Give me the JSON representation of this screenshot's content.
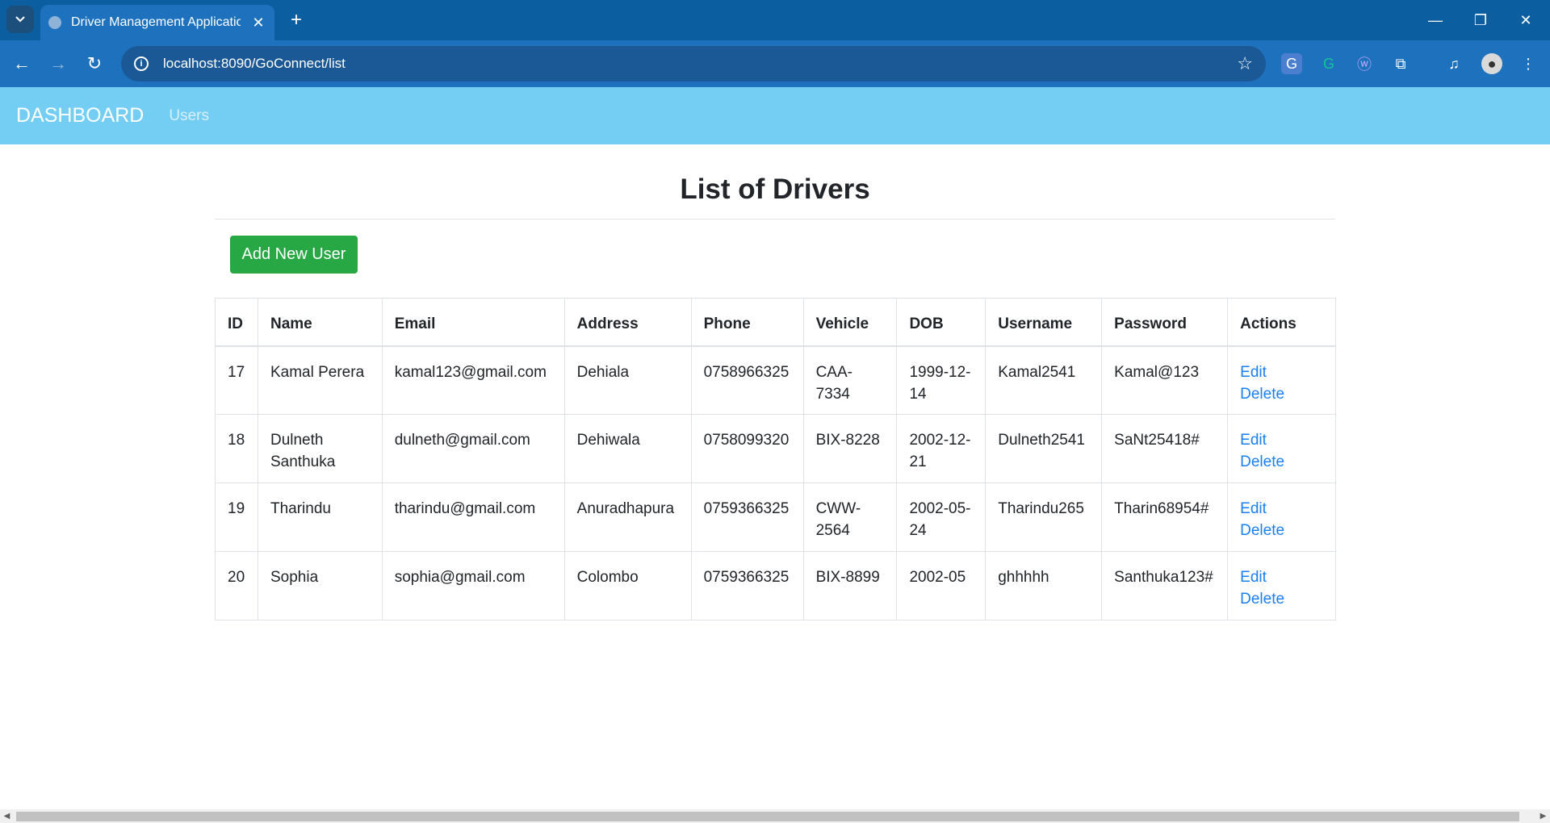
{
  "browser": {
    "tab_title": "Driver Management Application",
    "url": "localhost:8090/GoConnect/list",
    "icons": {
      "tab_search": "chevron-down-icon",
      "close_tab": "close-icon",
      "new_tab": "plus-icon",
      "back": "arrow-left-icon",
      "forward": "arrow-right-icon",
      "reload": "reload-icon",
      "site_info": "info-icon",
      "bookmark": "star-icon"
    },
    "extensions": [
      "translate-icon",
      "grammarly-icon",
      "w-extension-icon",
      "puzzle-icon",
      "media-icon",
      "profile-avatar-icon",
      "menu-dots-icon"
    ],
    "colors": {
      "tabstrip": "#0b5fa0",
      "toolbar": "#1e72bd",
      "omnibox": "#1a5996"
    }
  },
  "navbar": {
    "brand": "DASHBOARD",
    "link": "Users",
    "background": "#74cef3"
  },
  "main": {
    "title": "List of Drivers",
    "add_button": "Add New User",
    "add_button_color": "#28a745",
    "link_color": "#1a7ff0"
  },
  "table": {
    "headers": [
      "ID",
      "Name",
      "Email",
      "Address",
      "Phone",
      "Vehicle",
      "DOB",
      "Username",
      "Password",
      "Actions"
    ],
    "rows": [
      {
        "id": "17",
        "name": "Kamal Perera",
        "email": "kamal123@gmail.com",
        "address": "Dehiala",
        "phone": "0758966325",
        "vehicle": "CAA-7334",
        "dob": "1999-12-14",
        "username": "Kamal2541",
        "password": "Kamal@123",
        "edit": "Edit",
        "delete": "Delete"
      },
      {
        "id": "18",
        "name": "Dulneth Santhuka",
        "email": "dulneth@gmail.com",
        "address": "Dehiwala",
        "phone": "0758099320",
        "vehicle": "BIX-8228",
        "dob": "2002-12-21",
        "username": "Dulneth2541",
        "password": "SaNt25418#",
        "edit": "Edit",
        "delete": "Delete"
      },
      {
        "id": "19",
        "name": "Tharindu",
        "email": "tharindu@gmail.com",
        "address": "Anuradhapura",
        "phone": "0759366325",
        "vehicle": "CWW-2564",
        "dob": "2002-05-24",
        "username": "Tharindu265",
        "password": "Tharin68954#",
        "edit": "Edit",
        "delete": "Delete"
      },
      {
        "id": "20",
        "name": "Sophia",
        "email": "sophia@gmail.com",
        "address": "Colombo",
        "phone": "0759366325",
        "vehicle": "BIX-8899",
        "dob": "2002-05",
        "username": "ghhhhh",
        "password": "Santhuka123#",
        "edit": "Edit",
        "delete": "Delete"
      }
    ]
  }
}
